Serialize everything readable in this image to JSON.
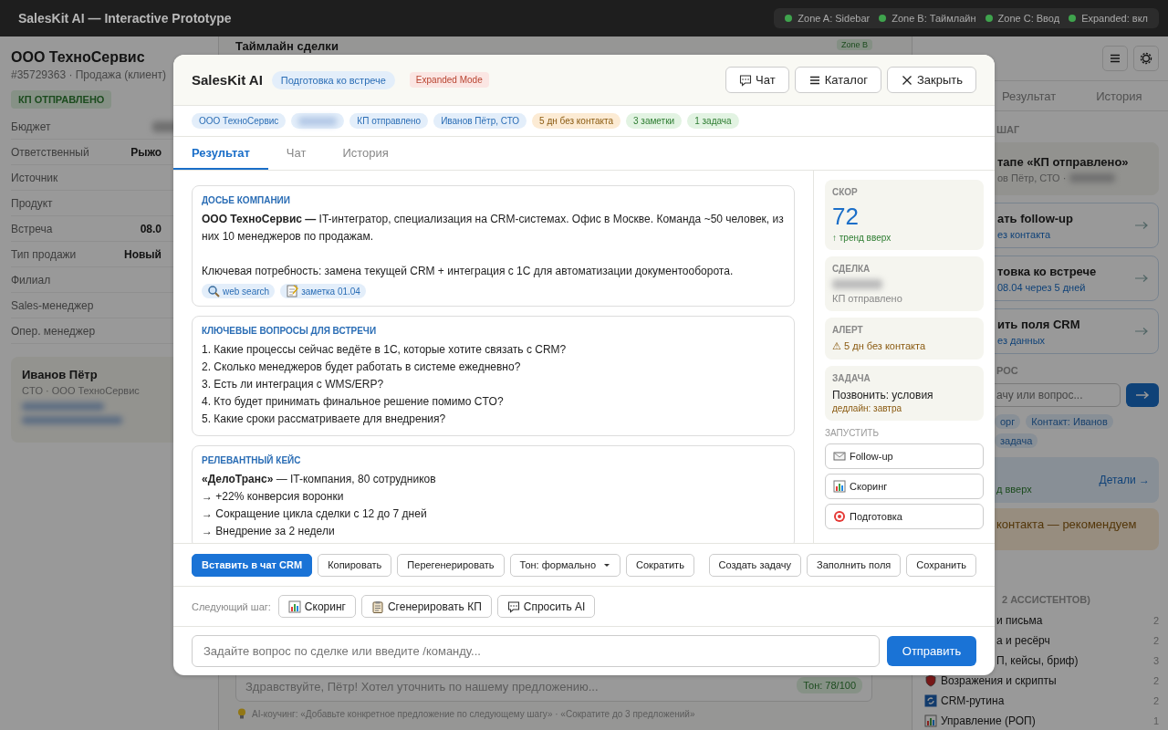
{
  "topbar": {
    "title": "SalesKit AI — Interactive Prototype",
    "zones": [
      "Zone A: Sidebar",
      "Zone B: Таймлайн",
      "Zone C: Ввод",
      "Expanded: вкл"
    ]
  },
  "sidebar": {
    "company": "ООО ТехноСервис",
    "meta": "#35729363 · Продажа (клиент)",
    "status": "КП ОТПРАВЛЕНО",
    "fields": [
      {
        "label": "Бюджет",
        "redacted": true
      },
      {
        "label": "Ответственный",
        "value": "Рыжо"
      },
      {
        "label": "Источник"
      },
      {
        "label": "Продукт"
      },
      {
        "label": "Встреча",
        "value": "08.0"
      },
      {
        "label": "Тип продажи",
        "value": "Новый"
      },
      {
        "label": "Филиал"
      },
      {
        "label": "Sales-менеджер"
      },
      {
        "label": "Опер. менеджер"
      }
    ],
    "contact": {
      "name": "Иванов Пётр",
      "role": "CTO · ООО ТехноСервис",
      "redacted": true
    }
  },
  "timeline": {
    "title": "Таймлайн сделки",
    "zone_badge": "Zone B",
    "draft_placeholder": "Здравствуйте, Пётр! Хотел уточнить по нашему предложению...",
    "tone": "Тон: 78/100",
    "coach": "AI-коучинг: «Добавьте конкретное предложение по следующему шагу» · «Сократите до 3 предложений»"
  },
  "assistant": {
    "tabs": [
      {
        "label": "Результат",
        "selected": false
      },
      {
        "label": "История",
        "selected": false
      }
    ],
    "step_label": "ШАГ",
    "cards": [
      {
        "kind": "current",
        "title": "тапе «КП отправлено»",
        "sub": "ов Пётр, СТО ·",
        "redacted": true
      },
      {
        "kind": "action",
        "title": "ать follow-up",
        "sub": "ез контакта"
      },
      {
        "kind": "action",
        "title": "товка ко встрече",
        "sub": "08.04 через 5 дней"
      },
      {
        "kind": "action",
        "title": "ить поля CRM",
        "sub": "ез данных"
      }
    ],
    "ask_label": "РОС",
    "ask_placeholder": "ачу или вопрос...",
    "chips": [
      "орг",
      "Контакт: Иванов",
      "задача"
    ],
    "score_text": "д вверх",
    "details_link": "Детали →",
    "warning": "контакта — рекомендуем",
    "list_label": "2 АССИСТЕНТОВ)",
    "groups": [
      {
        "label": "и письма",
        "count": "2"
      },
      {
        "label": "а и ресёрч",
        "count": "2"
      },
      {
        "label": "П, кейсы, бриф)",
        "count": "3"
      },
      {
        "label": "Возражения и скрипты",
        "count": "2"
      },
      {
        "label": "CRM-рутина",
        "count": "2"
      },
      {
        "label": "Управление (РОП)",
        "count": "1"
      }
    ]
  },
  "modal": {
    "title": "SalesKit AI",
    "mode": "Подготовка ко встрече",
    "badge": "Expanded Mode",
    "buttons": [
      "Чат",
      "Каталог",
      "Закрыть"
    ],
    "chips": [
      {
        "label": "ООО ТехноСервис",
        "color": "#e3eefa"
      },
      {
        "redacted": true,
        "color": "#e3eefa"
      },
      {
        "label": "КП отправлено",
        "color": "#e3eefa"
      },
      {
        "label": "Иванов Пётр, СТО",
        "color": "#e3eefa"
      },
      {
        "label": "5 дн без контакта",
        "color": "#fcebd4"
      },
      {
        "label": "3 заметки",
        "color": "#e2f3e2"
      },
      {
        "label": "1 задача",
        "color": "#e2f3e2"
      }
    ],
    "tabs": [
      {
        "label": "Результат",
        "selected": true
      },
      {
        "label": "Чат",
        "selected": false
      },
      {
        "label": "История",
        "selected": false
      }
    ],
    "sections": [
      {
        "kind": "prose",
        "heading": "ДОСЬЕ КОМПАНИИ",
        "lines": [
          "**ООО ТехноСервис —** IT-интегратор, специализация на CRM-системах. Офис в Москве. Команда ~50 человек, из них 10 менеджеров по продажам.",
          "Ключевая потребность: замена текущей CRM + интеграция с 1С для автоматизации документооборота."
        ],
        "sources": [
          "web search",
          "заметка 01.04"
        ]
      },
      {
        "kind": "list",
        "heading": "КЛЮЧЕВЫЕ ВОПРОСЫ ДЛЯ ВСТРЕЧИ",
        "lines": [
          "1. Какие процессы сейчас ведёте в 1С, которые хотите связать с CRM?",
          "2. Сколько менеджеров будет работать в системе ежедневно?",
          "3. Есть ли интеграция с WMS/ERP?",
          "4. Кто будет принимать финальное решение помимо CTO?",
          "5. Какие сроки рассматриваете для внедрения?"
        ]
      },
      {
        "kind": "list",
        "heading": "РЕЛЕВАНТНЫЙ КЕЙС",
        "lines": [
          "**«ДелоТранс»** — IT-компания, 80 сотрудников",
          "→ +22% конверсия воронки",
          "→ Сокращение цикла сделки с 12 до 7 дней",
          "→ Внедрение за 2 недели"
        ]
      }
    ],
    "stats": [
      {
        "kind": "score",
        "label": "СКОР",
        "value": "72",
        "sub": "↑ тренд вверх"
      },
      {
        "kind": "deal",
        "label": "СДЕЛКА",
        "redacted": true,
        "sub": "КП отправлено"
      },
      {
        "kind": "alert",
        "label": "АЛЕРТ",
        "value": "⚠ 5 дн без контакта"
      },
      {
        "kind": "task",
        "label": "ЗАДАЧА",
        "value": "Позвонить: условия",
        "sub": "дедлайн: завтра"
      }
    ],
    "launch_label": "ЗАПУСТИТЬ",
    "launch": [
      "Follow-up",
      "Скоринг",
      "Подготовка"
    ],
    "actions": [
      {
        "label": "Вставить в чат CRM",
        "kind": "primary"
      },
      {
        "label": "Копировать",
        "kind": "plain"
      },
      {
        "label": "Перегенерировать",
        "kind": "plain"
      },
      {
        "label": "Тон: формально",
        "kind": "dropdown"
      },
      {
        "label": "Сократить",
        "kind": "plain"
      }
    ],
    "actions_right": [
      "Создать задачу",
      "Заполнить поля",
      "Сохранить"
    ],
    "next_label": "Следующий шаг:",
    "next": [
      "Скоринг",
      "Сгенерировать КП",
      "Спросить AI"
    ],
    "composer_placeholder": "Задайте вопрос по сделке или введите /команду...",
    "send": "Отправить"
  }
}
